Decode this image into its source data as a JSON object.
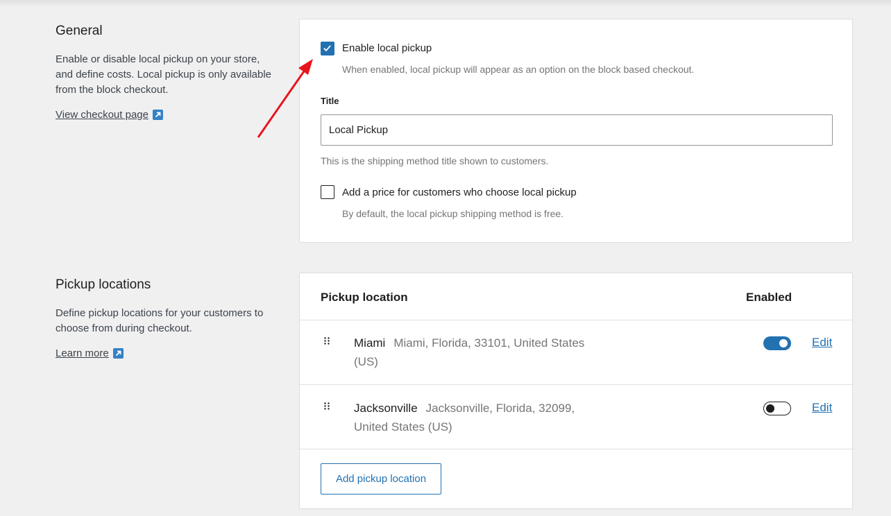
{
  "general": {
    "heading": "General",
    "description": "Enable or disable local pickup on your store, and define costs. Local pickup is only available from the block checkout.",
    "link_label": "View checkout page",
    "link_icon": "external-link-icon"
  },
  "settings": {
    "enable_label": "Enable local pickup",
    "enable_checked": true,
    "enable_help": "When enabled, local pickup will appear as an option on the block based checkout.",
    "title_label": "Title",
    "title_value": "Local Pickup",
    "title_help": "This is the shipping method title shown to customers.",
    "price_label": "Add a price for customers who choose local pickup",
    "price_checked": false,
    "price_help": "By default, the local pickup shipping method is free."
  },
  "pickup": {
    "heading": "Pickup locations",
    "description": "Define pickup locations for your customers to choose from during checkout.",
    "link_label": "Learn more",
    "link_icon": "external-link-icon",
    "col_location": "Pickup location",
    "col_enabled": "Enabled",
    "locations": [
      {
        "name": "Miami",
        "address": "Miami, Florida, 33101, United States (US)",
        "enabled": true,
        "edit_label": "Edit"
      },
      {
        "name": "Jacksonville",
        "address": "Jacksonville, Florida, 32099, United States (US)",
        "enabled": false,
        "edit_label": "Edit"
      }
    ],
    "add_label": "Add pickup location"
  },
  "colors": {
    "accent": "#2271b1",
    "annotation_arrow": "#e8141c"
  }
}
